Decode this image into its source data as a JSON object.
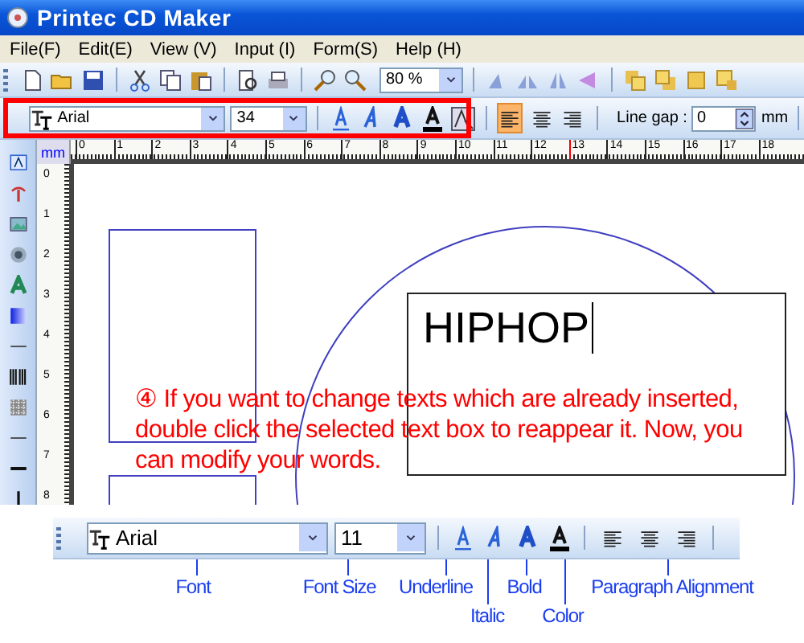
{
  "window": {
    "title": "Printec CD Maker"
  },
  "menu": [
    {
      "label": "File(F)"
    },
    {
      "label": "Edit(E)"
    },
    {
      "label": "View (V)"
    },
    {
      "label": "Input (I)"
    },
    {
      "label": "Form(S)"
    },
    {
      "label": "Help (H)"
    }
  ],
  "toolbar": {
    "zoom": "80 %"
  },
  "text_toolbar": {
    "font": "Arial",
    "size": "34",
    "alignment": [
      {
        "selected": true
      },
      {
        "selected": false
      },
      {
        "selected": false
      }
    ],
    "line_gap_label": "Line gap :",
    "line_gap": "0",
    "unit": "mm"
  },
  "ruler": {
    "unit": "mm",
    "marks": [
      "0",
      "1",
      "2",
      "3",
      "4",
      "5",
      "6",
      "7",
      "8",
      "9",
      "10",
      "11",
      "12",
      "13",
      "14",
      "15",
      "16",
      "17",
      "18"
    ],
    "vertical_marks": [
      "0",
      "1",
      "2",
      "3",
      "4",
      "5",
      "6",
      "7",
      "8"
    ]
  },
  "canvas": {
    "text_box": "HIPHOP",
    "instruction": [
      "④ If you want to change texts which are already inserted,",
      "double click the selected text box to reappear it. Now, you",
      "can modify your words."
    ]
  },
  "callout": {
    "font": "Arial",
    "size": "11",
    "alignment": [
      {
        "selected": false
      },
      {
        "selected": false
      },
      {
        "selected": false
      }
    ],
    "labels": [
      {
        "text": "Font",
        "kind": "upper"
      },
      {
        "text": "Font Size",
        "kind": "upper"
      },
      {
        "text": "Underline",
        "kind": "upper"
      },
      {
        "text": "Italic",
        "kind": "lower"
      },
      {
        "text": "Bold",
        "kind": "upper"
      },
      {
        "text": "Color",
        "kind": "lower"
      },
      {
        "text": "Paragraph Alignment",
        "kind": "upper"
      }
    ]
  }
}
